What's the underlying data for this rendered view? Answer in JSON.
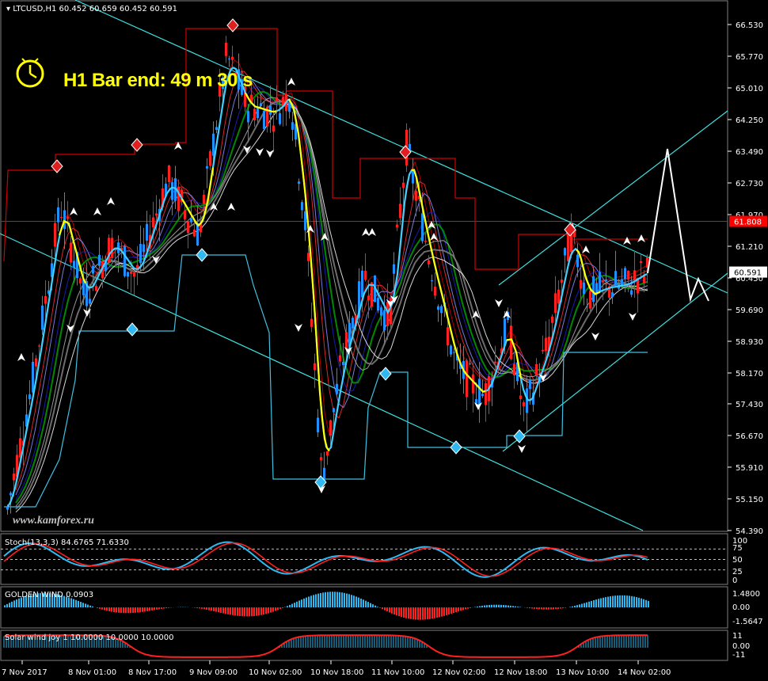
{
  "header": {
    "symbol_tf": "LTCUSD,H1",
    "ohlc": "60.452 60.659 60.452 60.591"
  },
  "timer_text": "H1 Bar end: 49 m 30 s",
  "watermark": "www.kamforex.ru",
  "price_axis": {
    "ticks": [
      "66.530",
      "65.770",
      "65.010",
      "64.250",
      "63.490",
      "62.730",
      "61.970",
      "61.210",
      "60.450",
      "59.690",
      "58.930",
      "58.170",
      "57.430",
      "56.670",
      "55.910",
      "55.150",
      "54.390"
    ],
    "current_price": "60.591",
    "red_line_price": "61.808",
    "current_price_color": "#ffffff",
    "red_line_color": "#ff0000"
  },
  "time_axis": {
    "ticks": [
      "7 Nov 2017",
      "8 Nov 01:00",
      "8 Nov 17:00",
      "9 Nov 09:00",
      "10 Nov 02:00",
      "10 Nov 18:00",
      "11 Nov 10:00",
      "12 Nov 02:00",
      "12 Nov 18:00",
      "13 Nov 10:00",
      "14 Nov 02:00"
    ]
  },
  "stoch_panel": {
    "label": "Stoch(13,3,3) 84.6765 71.6330",
    "levels": [
      "100",
      "75",
      "50",
      "25",
      "0"
    ]
  },
  "golden_panel": {
    "label": "GOLDEN WIND 0.0903",
    "levels": [
      "1.4800",
      "0.00",
      "-1.5647"
    ]
  },
  "solar_panel": {
    "label": "Solar wind joy 1 10.0000 10.0000 10.0000",
    "levels": [
      "11",
      "0.00",
      "-11"
    ]
  },
  "colors": {
    "bull_candle": "#1e90ff",
    "bear_candle": "#ff2020",
    "channel": "#40e0e0",
    "envelope_red": "#d00000",
    "envelope_cyan": "#40c0e0",
    "fast_line": "#40d0ff",
    "highlight": "#ffff00"
  }
}
